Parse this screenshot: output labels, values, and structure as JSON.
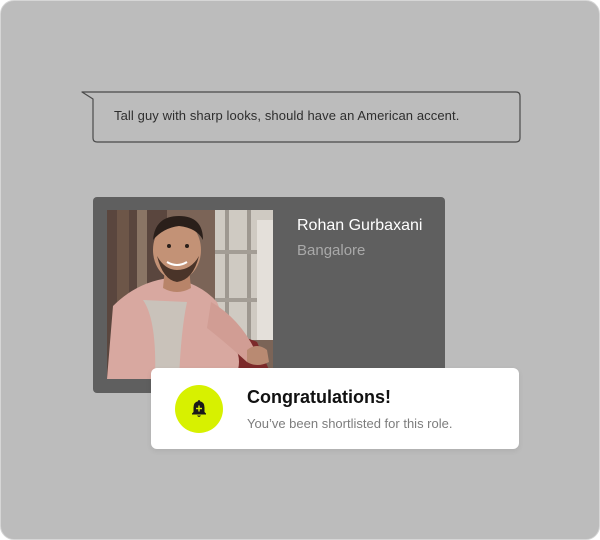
{
  "prompt": {
    "text": "Tall guy with sharp looks, should have an American accent."
  },
  "profile": {
    "name": "Rohan Gurbaxani",
    "location": "Bangalore",
    "photo_icon": "person-photo"
  },
  "notification": {
    "icon": "bell-icon",
    "title": "Congratulations!",
    "message": "You’ve been shortlisted for this role."
  },
  "colors": {
    "background": "#bcbcbc",
    "card": "#5f5f5f",
    "accent": "#d7f100",
    "notification_bg": "#ffffff"
  }
}
